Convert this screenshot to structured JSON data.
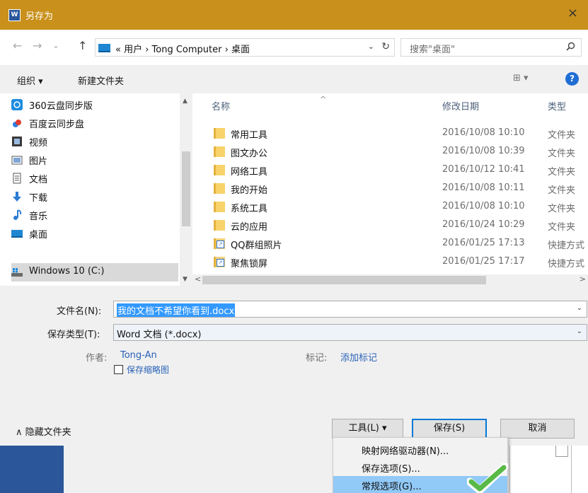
{
  "title_bar": {
    "app_icon_letter": "W",
    "title": "另存为",
    "close_glyph": "×"
  },
  "address_bar": {
    "back": "←",
    "forward": "→",
    "recent": "⌄",
    "up": "↑",
    "breadcrumb": "« 用户 › Tong Computer › 桌面",
    "dropdown": "⌄",
    "refresh": "↻",
    "search_placeholder": "搜索\"桌面\"",
    "search_icon": "⌕"
  },
  "toolbar": {
    "organize": "组织 ▾",
    "new_folder": "新建文件夹",
    "views": "⊞ ▾",
    "help": "?"
  },
  "nav_pane": {
    "items": [
      {
        "label": "360云盘同步版",
        "icon": "cloud-icon"
      },
      {
        "label": "百度云同步盘",
        "icon": "baidu-cloud-icon"
      },
      {
        "label": "视频",
        "icon": "video-icon"
      },
      {
        "label": "图片",
        "icon": "picture-icon"
      },
      {
        "label": "文档",
        "icon": "document-icon"
      },
      {
        "label": "下载",
        "icon": "download-icon"
      },
      {
        "label": "音乐",
        "icon": "music-icon"
      },
      {
        "label": "桌面",
        "icon": "desktop-icon"
      },
      {
        "label": "Windows 10 (C:)",
        "icon": "drive-icon",
        "selected": true
      }
    ]
  },
  "file_list": {
    "columns": {
      "name": "名称",
      "date": "修改日期",
      "type": "类型"
    },
    "sort_arrow": "^",
    "rows": [
      {
        "name": "常用工具",
        "date": "2016/10/08 10:10",
        "type": "文件夹",
        "kind": "folder"
      },
      {
        "name": "图文办公",
        "date": "2016/10/08 10:39",
        "type": "文件夹",
        "kind": "folder"
      },
      {
        "name": "网络工具",
        "date": "2016/10/12 10:41",
        "type": "文件夹",
        "kind": "folder"
      },
      {
        "name": "我的开始",
        "date": "2016/10/08 10:11",
        "type": "文件夹",
        "kind": "folder"
      },
      {
        "name": "系统工具",
        "date": "2016/10/08 10:10",
        "type": "文件夹",
        "kind": "folder"
      },
      {
        "name": "云的应用",
        "date": "2016/10/24 10:29",
        "type": "文件夹",
        "kind": "folder"
      },
      {
        "name": "QQ群组照片",
        "date": "2016/01/25 17:13",
        "type": "快捷方式",
        "kind": "shortcut"
      },
      {
        "name": "聚焦锁屏",
        "date": "2016/01/25 17:17",
        "type": "快捷方式",
        "kind": "shortcut"
      }
    ]
  },
  "scroll": {
    "up": "▲",
    "down": "▼",
    "left": "<",
    "right": ">"
  },
  "form": {
    "filename_label": "文件名(N):",
    "filename_value": "我的文档不希望你看到.docx",
    "filetype_label": "保存类型(T):",
    "filetype_value": "Word 文档 (*.docx)",
    "dropdown_arrow": "⌄",
    "author_label": "作者:",
    "author_value": "Tong-An",
    "tags_label": "标记:",
    "tags_value": "添加标记",
    "thumbnail_label": "保存缩略图",
    "hide_folders": "∧ 隐藏文件夹",
    "tools_button": "工具(L)  ▾",
    "save_button": "保存(S)",
    "cancel_button": "取消"
  },
  "tools_menu": {
    "items": [
      {
        "label": "映射网络驱动器(N)..."
      },
      {
        "label": "保存选项(S)..."
      },
      {
        "label": "常规选项(G)...",
        "highlighted": true
      }
    ]
  },
  "colors": {
    "titlebar": "#c9901b",
    "accent": "#0078d7",
    "selection": "#3399ff"
  }
}
